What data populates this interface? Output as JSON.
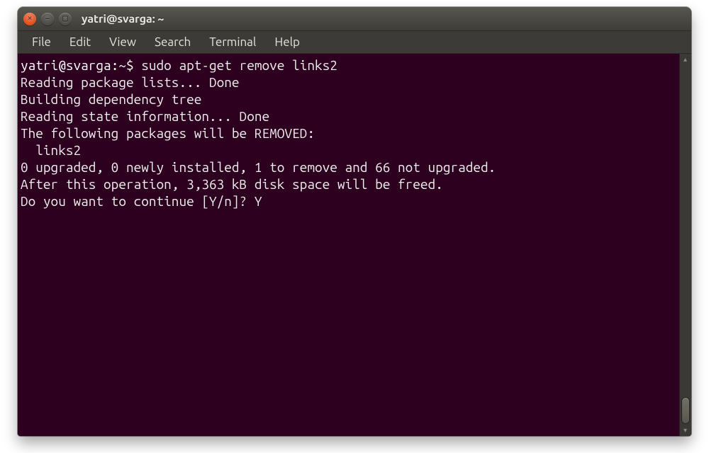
{
  "window": {
    "title": "yatri@svarga: ~"
  },
  "menu": {
    "items": [
      "File",
      "Edit",
      "View",
      "Search",
      "Terminal",
      "Help"
    ]
  },
  "prompt": {
    "userhost": "yatri@svarga",
    "sep": ":",
    "path": "~",
    "symbol": "$"
  },
  "command": "sudo apt-get remove links2",
  "output_lines": [
    "Reading package lists... Done",
    "Building dependency tree",
    "Reading state information... Done",
    "The following packages will be REMOVED:",
    "  links2",
    "0 upgraded, 0 newly installed, 1 to remove and 66 not upgraded.",
    "After this operation, 3,363 kB disk space will be freed.",
    "Do you want to continue [Y/n]? Y"
  ],
  "colors": {
    "term_bg": "#2c001e",
    "term_fg": "#eeeeec",
    "chrome_bg": "#3c3b37"
  }
}
